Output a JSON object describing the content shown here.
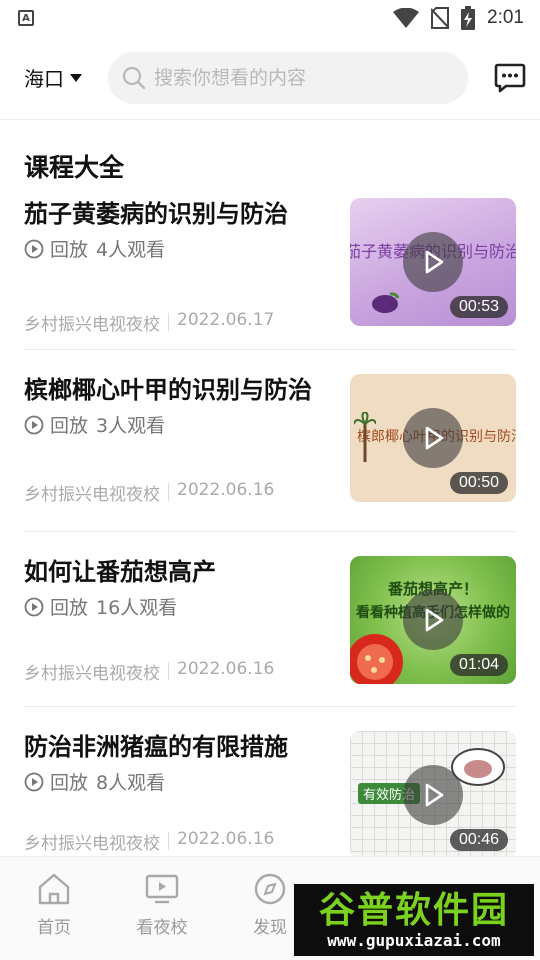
{
  "status_bar": {
    "time": "2:01",
    "notification_badge": "A"
  },
  "header": {
    "city": "海口",
    "search_placeholder": "搜索你想看的内容"
  },
  "section_title": "课程大全",
  "courses": [
    {
      "title": "茄子黄萎病的识别与防治",
      "replay_label": "回放",
      "viewers": "4人观看",
      "source": "乡村振兴电视夜校",
      "date": "2022.06.17",
      "duration": "00:53",
      "thumb_text": "茄子黄萎病的识别与防治"
    },
    {
      "title": "槟榔椰心叶甲的识别与防治",
      "replay_label": "回放",
      "viewers": "3人观看",
      "source": "乡村振兴电视夜校",
      "date": "2022.06.16",
      "duration": "00:50",
      "thumb_text": "槟郎椰心叶甲的识别与防治"
    },
    {
      "title": "如何让番茄想高产",
      "replay_label": "回放",
      "viewers": "16人观看",
      "source": "乡村振兴电视夜校",
      "date": "2022.06.16",
      "duration": "01:04",
      "thumb_text": "番茄想高产！",
      "thumb_text2": "看看种植高手们怎样做的"
    },
    {
      "title": "防治非洲猪瘟的有限措施",
      "replay_label": "回放",
      "viewers": "8人观看",
      "source": "乡村振兴电视夜校",
      "date": "2022.06.16",
      "duration": "00:46",
      "thumb_text": "有效防治"
    }
  ],
  "bottom_nav": [
    {
      "label": "首页",
      "icon": "home-icon"
    },
    {
      "label": "看夜校",
      "icon": "tv-play-icon"
    },
    {
      "label": "发现",
      "icon": "compass-icon"
    }
  ],
  "watermark": {
    "title": "谷普软件园",
    "url": "www.gupuxiazai.com"
  }
}
